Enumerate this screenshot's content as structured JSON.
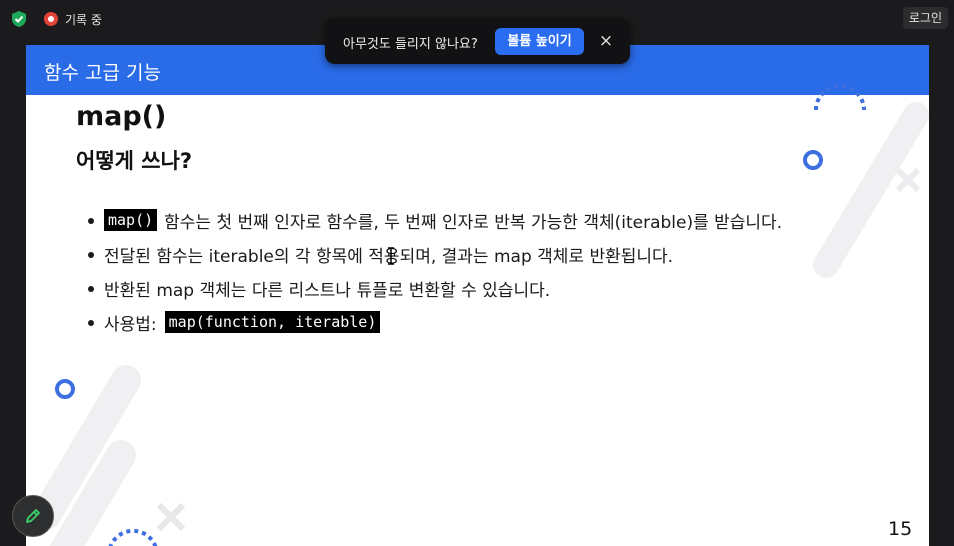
{
  "topbar": {
    "recording_label": "기록 중",
    "login_label": "로그인"
  },
  "toast": {
    "message": "아무것도 들리지 않나요?",
    "button_label": "볼륨 높이기",
    "close_glyph": "×"
  },
  "slide": {
    "header_title": "함수 고급 기능",
    "title": "map()",
    "subtitle": "어떻게 쓰나?",
    "bullets": [
      {
        "code": "map()",
        "text": "함수는 첫 번째 인자로 함수를, 두 번째 인자로 반복 가능한 객체(iterable)를 받습니다."
      },
      {
        "text": "전달된 함수는 iterable의 각 항목에 적용되며, 결과는 map 객체로 반환됩니다."
      },
      {
        "text": "반환된 map 객체는 다른 리스트나 튜플로 변환할 수 있습니다."
      },
      {
        "text": "사용법:",
        "code": "map(function, iterable)"
      }
    ],
    "page_number": "15"
  },
  "colors": {
    "header_blue": "#2a6be8",
    "accent_blue": "#3d6fe0",
    "record_red": "#e3423a",
    "shield_green": "#1fa85a"
  },
  "icons": [
    "shield-icon",
    "record-icon",
    "close-icon",
    "pen-icon",
    "text-cursor-icon"
  ]
}
